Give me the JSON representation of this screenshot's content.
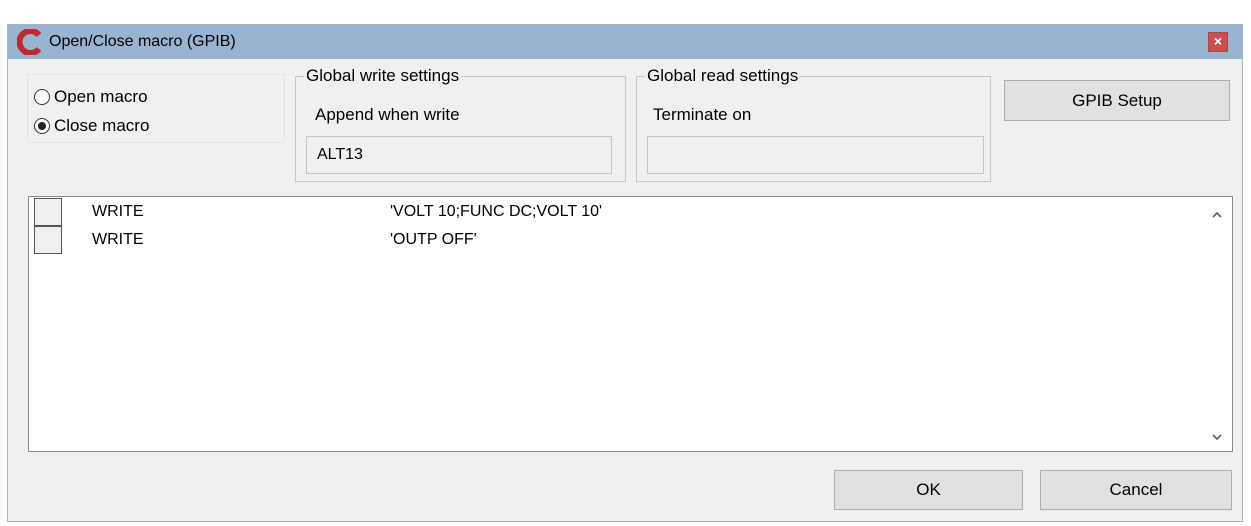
{
  "window": {
    "title": "Open/Close macro (GPIB)",
    "close_glyph": "×"
  },
  "macro_type": {
    "options": [
      {
        "label": "Open macro",
        "selected": false
      },
      {
        "label": "Close macro",
        "selected": true
      }
    ]
  },
  "write_settings": {
    "legend": "Global write settings",
    "label": "Append when write",
    "value": "ALT13"
  },
  "read_settings": {
    "legend": "Global read settings",
    "label": "Terminate on",
    "value": ""
  },
  "buttons": {
    "gpib_setup": "GPIB Setup",
    "ok": "OK",
    "cancel": "Cancel"
  },
  "commands": [
    {
      "command": "WRITE",
      "argument": "'VOLT 10;FUNC DC;VOLT 10'"
    },
    {
      "command": "WRITE",
      "argument": "'OUTP OFF'"
    }
  ],
  "colors": {
    "title_bar": "#99b4d1",
    "close_button": "#c75050",
    "logo": "#c0282d"
  }
}
